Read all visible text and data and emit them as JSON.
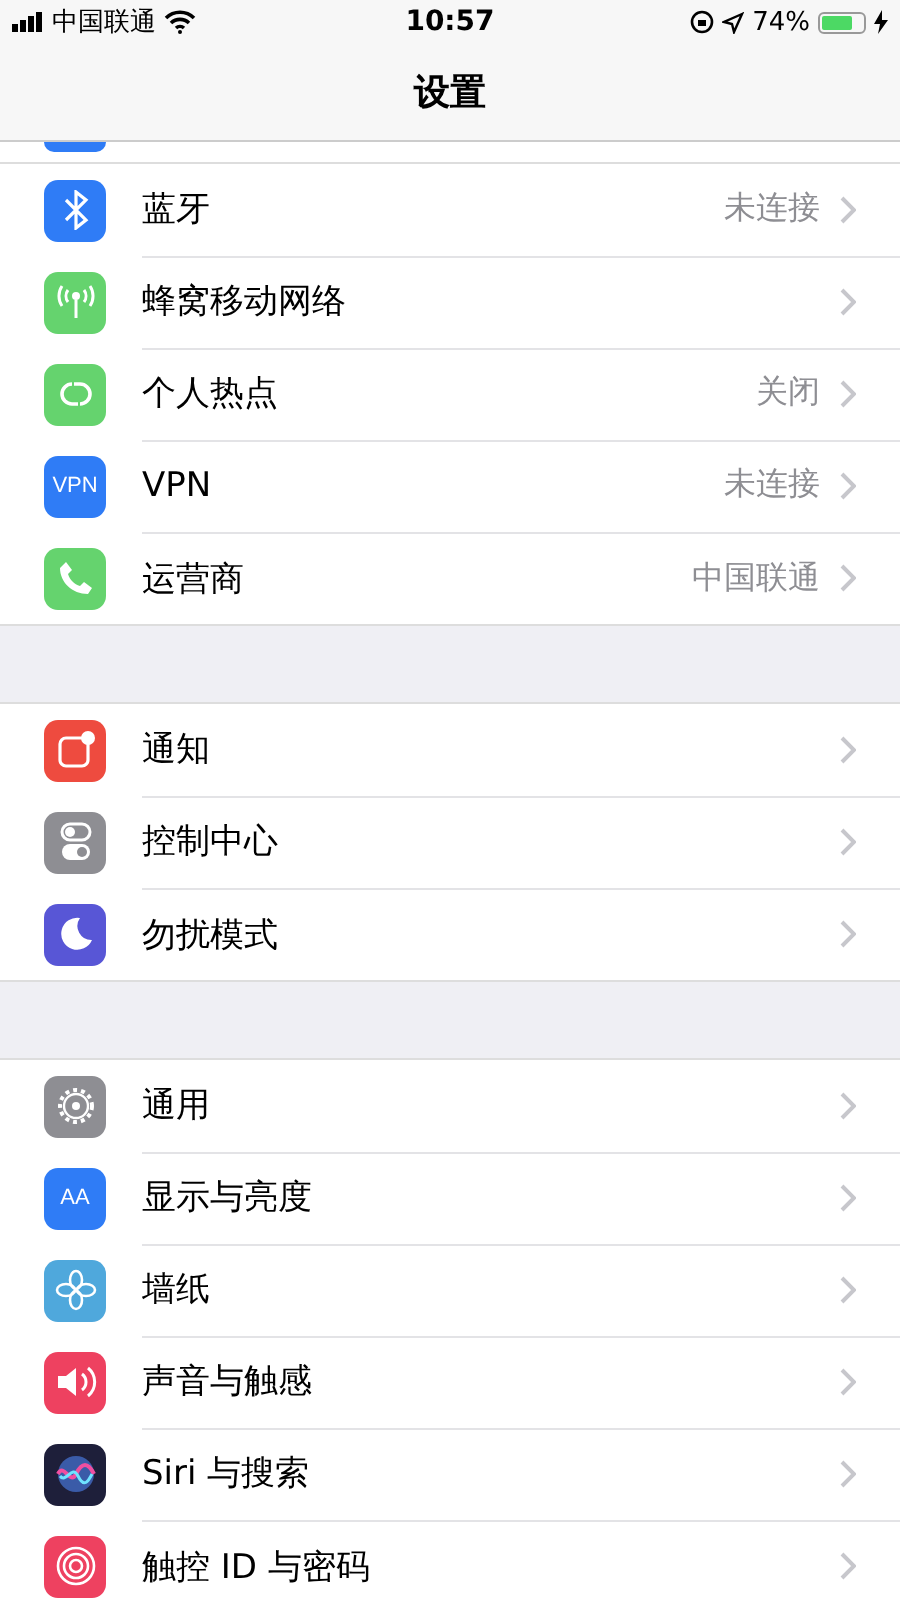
{
  "status_bar": {
    "carrier": "中国联通",
    "time": "10:57",
    "battery_text": "74%",
    "battery": {
      "level": 0.74
    },
    "charging": true
  },
  "nav": {
    "title": "设置"
  },
  "groups": [
    {
      "rows": [
        {
          "kind": "bluetooth",
          "label": "蓝牙",
          "value": "未连接"
        },
        {
          "kind": "cellular",
          "label": "蜂窝移动网络"
        },
        {
          "kind": "hotspot",
          "label": "个人热点",
          "value": "关闭"
        },
        {
          "kind": "vpn",
          "icon_text": "VPN",
          "label": "VPN",
          "value": "未连接"
        },
        {
          "kind": "phone",
          "label": "运营商",
          "value": "中国联通"
        }
      ]
    },
    {
      "rows": [
        {
          "kind": "notifications",
          "label": "通知"
        },
        {
          "kind": "control",
          "label": "控制中心"
        },
        {
          "kind": "moon",
          "label": "勿扰模式"
        }
      ]
    },
    {
      "rows": [
        {
          "kind": "gear",
          "label": "通用"
        },
        {
          "kind": "display",
          "icon_text": "AA",
          "label": "显示与亮度"
        },
        {
          "kind": "flower",
          "label": "墙纸"
        },
        {
          "kind": "sound",
          "label": "声音与触感"
        },
        {
          "kind": "siri",
          "label": "Siri 与搜索"
        },
        {
          "kind": "touchid",
          "label": "触控 ID 与密码"
        }
      ]
    }
  ]
}
